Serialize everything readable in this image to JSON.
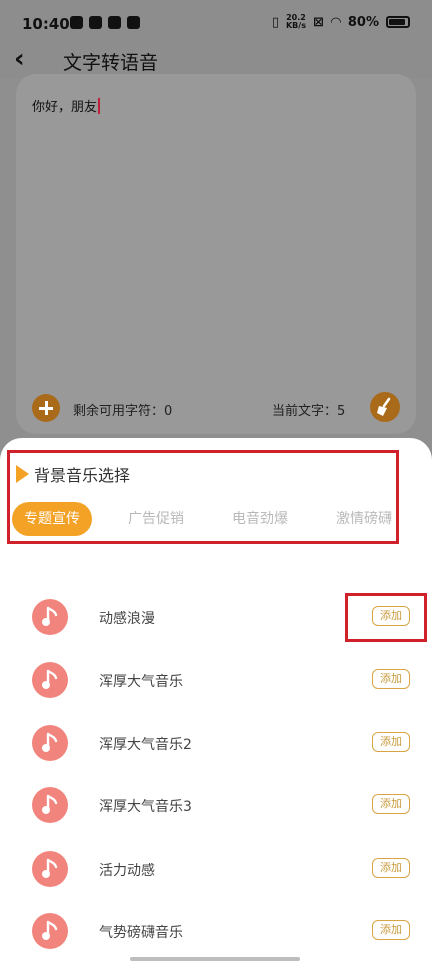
{
  "status_bar": {
    "time": "10:40",
    "speed_top": "20.2",
    "speed_unit": "KB/s",
    "battery": "80%"
  },
  "header": {
    "title": "文字转语音"
  },
  "editor": {
    "text": "你好，朋友",
    "remaining_label": "剩余可用字符：0",
    "current_label": "当前文字：5"
  },
  "music": {
    "section_title": "背景音乐选择",
    "tabs": [
      "专题宣传",
      "广告促销",
      "电音劲爆",
      "激情磅礴"
    ],
    "add_label": "添加",
    "songs": [
      "动感浪漫",
      "浑厚大气音乐",
      "浑厚大气音乐2",
      "浑厚大气音乐3",
      "活力动感",
      "气势磅礴音乐"
    ]
  },
  "colors": {
    "accent": "#f3a226",
    "note_bg": "#f1857d",
    "highlight": "#d0202a"
  }
}
